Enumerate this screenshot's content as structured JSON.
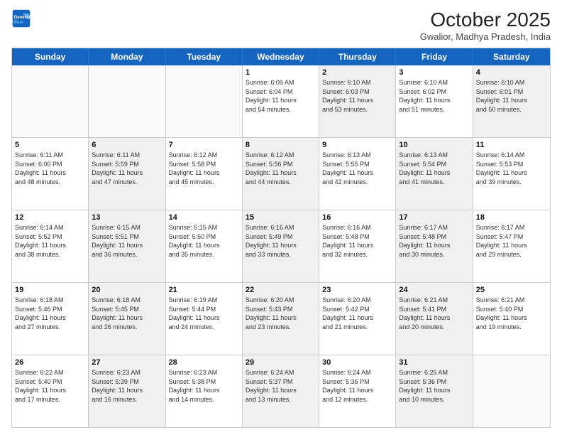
{
  "header": {
    "logo_line1": "General",
    "logo_line2": "Blue",
    "month": "October 2025",
    "location": "Gwalior, Madhya Pradesh, India"
  },
  "weekdays": [
    "Sunday",
    "Monday",
    "Tuesday",
    "Wednesday",
    "Thursday",
    "Friday",
    "Saturday"
  ],
  "rows": [
    [
      {
        "day": "",
        "info": "",
        "shaded": false,
        "empty": true
      },
      {
        "day": "",
        "info": "",
        "shaded": false,
        "empty": true
      },
      {
        "day": "",
        "info": "",
        "shaded": false,
        "empty": true
      },
      {
        "day": "1",
        "info": "Sunrise: 6:09 AM\nSunset: 6:04 PM\nDaylight: 11 hours\nand 54 minutes.",
        "shaded": false,
        "empty": false
      },
      {
        "day": "2",
        "info": "Sunrise: 6:10 AM\nSunset: 6:03 PM\nDaylight: 11 hours\nand 53 minutes.",
        "shaded": true,
        "empty": false
      },
      {
        "day": "3",
        "info": "Sunrise: 6:10 AM\nSunset: 6:02 PM\nDaylight: 11 hours\nand 51 minutes.",
        "shaded": false,
        "empty": false
      },
      {
        "day": "4",
        "info": "Sunrise: 6:10 AM\nSunset: 6:01 PM\nDaylight: 11 hours\nand 50 minutes.",
        "shaded": true,
        "empty": false
      }
    ],
    [
      {
        "day": "5",
        "info": "Sunrise: 6:11 AM\nSunset: 6:00 PM\nDaylight: 11 hours\nand 48 minutes.",
        "shaded": false,
        "empty": false
      },
      {
        "day": "6",
        "info": "Sunrise: 6:11 AM\nSunset: 5:59 PM\nDaylight: 11 hours\nand 47 minutes.",
        "shaded": true,
        "empty": false
      },
      {
        "day": "7",
        "info": "Sunrise: 6:12 AM\nSunset: 5:58 PM\nDaylight: 11 hours\nand 45 minutes.",
        "shaded": false,
        "empty": false
      },
      {
        "day": "8",
        "info": "Sunrise: 6:12 AM\nSunset: 5:56 PM\nDaylight: 11 hours\nand 44 minutes.",
        "shaded": true,
        "empty": false
      },
      {
        "day": "9",
        "info": "Sunrise: 6:13 AM\nSunset: 5:55 PM\nDaylight: 11 hours\nand 42 minutes.",
        "shaded": false,
        "empty": false
      },
      {
        "day": "10",
        "info": "Sunrise: 6:13 AM\nSunset: 5:54 PM\nDaylight: 11 hours\nand 41 minutes.",
        "shaded": true,
        "empty": false
      },
      {
        "day": "11",
        "info": "Sunrise: 6:14 AM\nSunset: 5:53 PM\nDaylight: 11 hours\nand 39 minutes.",
        "shaded": false,
        "empty": false
      }
    ],
    [
      {
        "day": "12",
        "info": "Sunrise: 6:14 AM\nSunset: 5:52 PM\nDaylight: 11 hours\nand 38 minutes.",
        "shaded": false,
        "empty": false
      },
      {
        "day": "13",
        "info": "Sunrise: 6:15 AM\nSunset: 5:51 PM\nDaylight: 11 hours\nand 36 minutes.",
        "shaded": true,
        "empty": false
      },
      {
        "day": "14",
        "info": "Sunrise: 6:15 AM\nSunset: 5:50 PM\nDaylight: 11 hours\nand 35 minutes.",
        "shaded": false,
        "empty": false
      },
      {
        "day": "15",
        "info": "Sunrise: 6:16 AM\nSunset: 5:49 PM\nDaylight: 11 hours\nand 33 minutes.",
        "shaded": true,
        "empty": false
      },
      {
        "day": "16",
        "info": "Sunrise: 6:16 AM\nSunset: 5:48 PM\nDaylight: 11 hours\nand 32 minutes.",
        "shaded": false,
        "empty": false
      },
      {
        "day": "17",
        "info": "Sunrise: 6:17 AM\nSunset: 5:48 PM\nDaylight: 11 hours\nand 30 minutes.",
        "shaded": true,
        "empty": false
      },
      {
        "day": "18",
        "info": "Sunrise: 6:17 AM\nSunset: 5:47 PM\nDaylight: 11 hours\nand 29 minutes.",
        "shaded": false,
        "empty": false
      }
    ],
    [
      {
        "day": "19",
        "info": "Sunrise: 6:18 AM\nSunset: 5:46 PM\nDaylight: 11 hours\nand 27 minutes.",
        "shaded": false,
        "empty": false
      },
      {
        "day": "20",
        "info": "Sunrise: 6:18 AM\nSunset: 5:45 PM\nDaylight: 11 hours\nand 26 minutes.",
        "shaded": true,
        "empty": false
      },
      {
        "day": "21",
        "info": "Sunrise: 6:19 AM\nSunset: 5:44 PM\nDaylight: 11 hours\nand 24 minutes.",
        "shaded": false,
        "empty": false
      },
      {
        "day": "22",
        "info": "Sunrise: 6:20 AM\nSunset: 5:43 PM\nDaylight: 11 hours\nand 23 minutes.",
        "shaded": true,
        "empty": false
      },
      {
        "day": "23",
        "info": "Sunrise: 6:20 AM\nSunset: 5:42 PM\nDaylight: 11 hours\nand 21 minutes.",
        "shaded": false,
        "empty": false
      },
      {
        "day": "24",
        "info": "Sunrise: 6:21 AM\nSunset: 5:41 PM\nDaylight: 11 hours\nand 20 minutes.",
        "shaded": true,
        "empty": false
      },
      {
        "day": "25",
        "info": "Sunrise: 6:21 AM\nSunset: 5:40 PM\nDaylight: 11 hours\nand 19 minutes.",
        "shaded": false,
        "empty": false
      }
    ],
    [
      {
        "day": "26",
        "info": "Sunrise: 6:22 AM\nSunset: 5:40 PM\nDaylight: 11 hours\nand 17 minutes.",
        "shaded": false,
        "empty": false
      },
      {
        "day": "27",
        "info": "Sunrise: 6:23 AM\nSunset: 5:39 PM\nDaylight: 11 hours\nand 16 minutes.",
        "shaded": true,
        "empty": false
      },
      {
        "day": "28",
        "info": "Sunrise: 6:23 AM\nSunset: 5:38 PM\nDaylight: 11 hours\nand 14 minutes.",
        "shaded": false,
        "empty": false
      },
      {
        "day": "29",
        "info": "Sunrise: 6:24 AM\nSunset: 5:37 PM\nDaylight: 11 hours\nand 13 minutes.",
        "shaded": true,
        "empty": false
      },
      {
        "day": "30",
        "info": "Sunrise: 6:24 AM\nSunset: 5:36 PM\nDaylight: 11 hours\nand 12 minutes.",
        "shaded": false,
        "empty": false
      },
      {
        "day": "31",
        "info": "Sunrise: 6:25 AM\nSunset: 5:36 PM\nDaylight: 11 hours\nand 10 minutes.",
        "shaded": true,
        "empty": false
      },
      {
        "day": "",
        "info": "",
        "shaded": false,
        "empty": true
      }
    ]
  ]
}
